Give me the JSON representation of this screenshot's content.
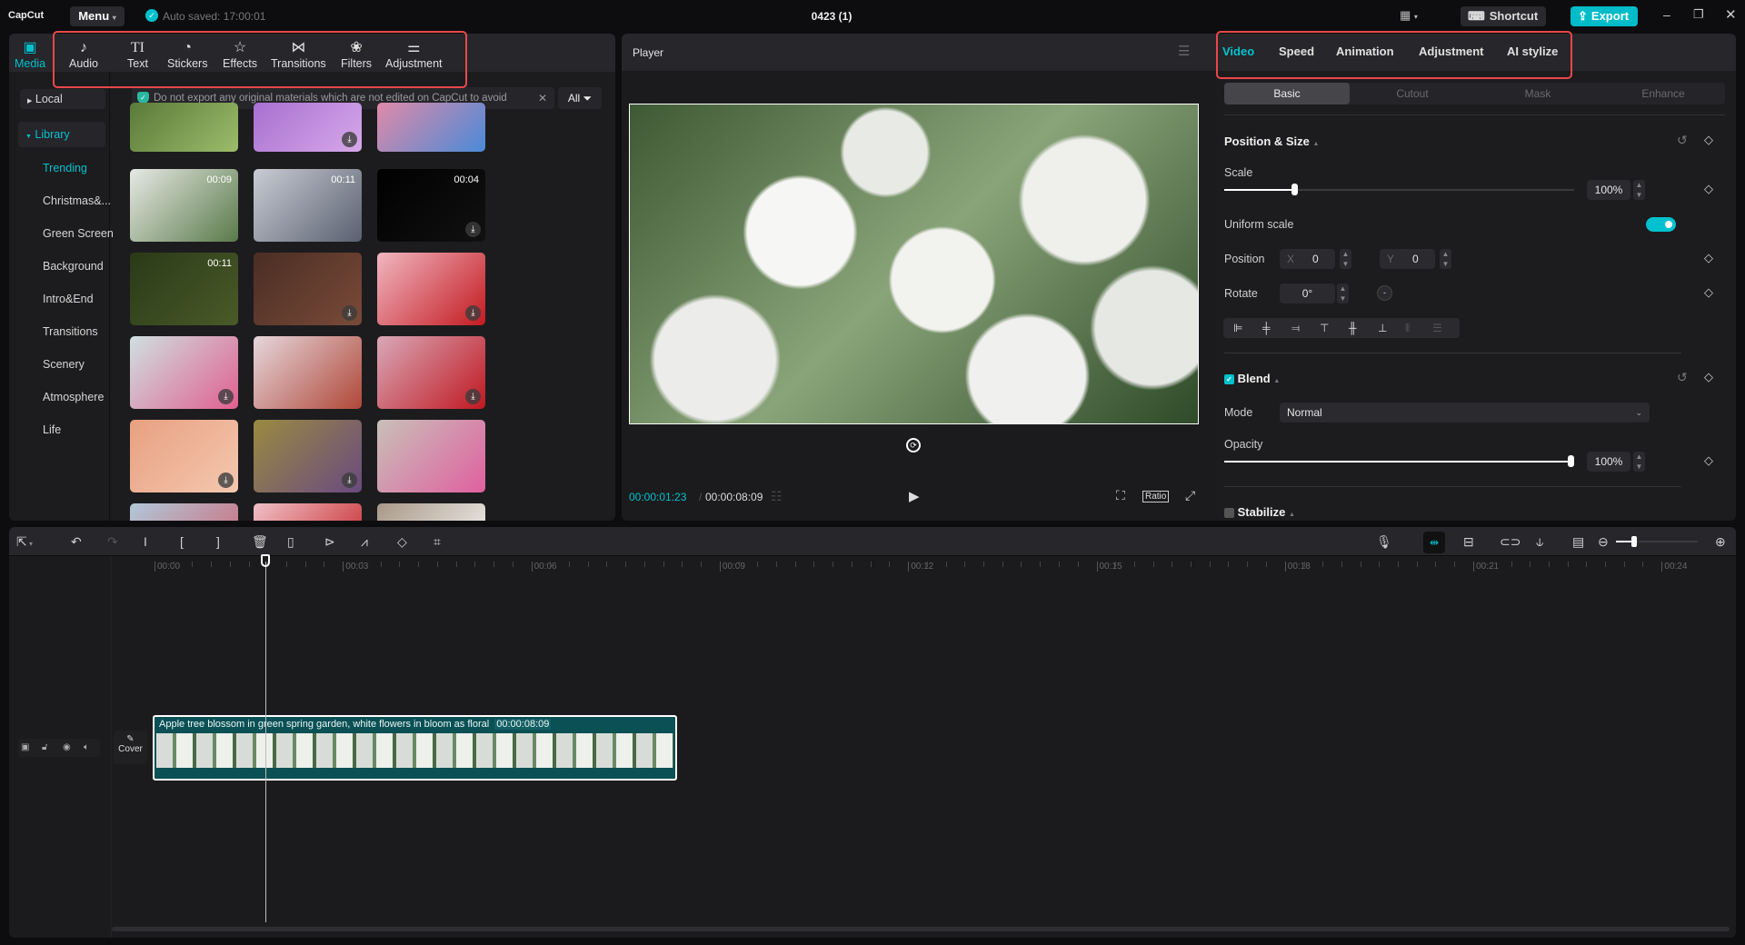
{
  "titlebar": {
    "logo": "CapCut",
    "menu": "Menu",
    "autosave": "Auto saved: 17:00:01",
    "project_title": "0423 (1)",
    "shortcut": "Shortcut",
    "export": "Export"
  },
  "left_tabs": [
    {
      "label": "Media",
      "icon": "media-icon",
      "active": true
    },
    {
      "label": "Audio",
      "icon": "audio-icon"
    },
    {
      "label": "Text",
      "icon": "text-icon"
    },
    {
      "label": "Stickers",
      "icon": "stickers-icon"
    },
    {
      "label": "Effects",
      "icon": "effects-icon"
    },
    {
      "label": "Transitions",
      "icon": "transitions-icon"
    },
    {
      "label": "Filters",
      "icon": "filters-icon"
    },
    {
      "label": "Adjustment",
      "icon": "adjustment-icon"
    }
  ],
  "sidebar": {
    "local": "Local",
    "library": "Library",
    "items": [
      "Trending",
      "Christmas&...",
      "Green Screen",
      "Background",
      "Intro&End",
      "Transitions",
      "Scenery",
      "Atmosphere",
      "Life"
    ]
  },
  "notice": "Do not export any original materials which are not edited on CapCut to avoid",
  "filter_all": "All",
  "thumbnails": [
    {
      "duration": "",
      "download": false,
      "colors": [
        "#5a7a3a",
        "#9cbc6a"
      ]
    },
    {
      "duration": "",
      "download": true,
      "colors": [
        "#a870d0",
        "#d7a8ea"
      ]
    },
    {
      "duration": "",
      "download": false,
      "colors": [
        "#e08aa8",
        "#4a8ad8"
      ]
    },
    {
      "duration": "00:09",
      "download": false,
      "colors": [
        "#e6e9e4",
        "#5a7a4a"
      ]
    },
    {
      "duration": "00:11",
      "download": false,
      "colors": [
        "#c8ccd4",
        "#5a6070"
      ]
    },
    {
      "duration": "00:04",
      "download": true,
      "colors": [
        "#000000",
        "#111111"
      ]
    },
    {
      "duration": "00:11",
      "download": false,
      "colors": [
        "#2a3a18",
        "#4a5a28"
      ]
    },
    {
      "duration": "",
      "download": true,
      "colors": [
        "#4a2e24",
        "#7a4a38"
      ]
    },
    {
      "duration": "",
      "download": true,
      "colors": [
        "#f0b6c0",
        "#c41a20"
      ]
    },
    {
      "duration": "",
      "download": true,
      "colors": [
        "#cfe0e0",
        "#e06090"
      ]
    },
    {
      "duration": "",
      "download": false,
      "colors": [
        "#e6d6dc",
        "#b04838"
      ]
    },
    {
      "duration": "",
      "download": true,
      "colors": [
        "#d8a8b8",
        "#c01820"
      ]
    },
    {
      "duration": "",
      "download": true,
      "colors": [
        "#e8a080",
        "#f4c8b0"
      ]
    },
    {
      "duration": "",
      "download": true,
      "colors": [
        "#9a8a40",
        "#6a4a80"
      ]
    },
    {
      "duration": "",
      "download": false,
      "colors": [
        "#c8c0b8",
        "#e060a0"
      ]
    },
    {
      "duration": "",
      "download": false,
      "colors": [
        "#b0c8d8",
        "#d06070"
      ]
    },
    {
      "duration": "",
      "download": false,
      "colors": [
        "#f0c0c8",
        "#c01818"
      ]
    },
    {
      "duration": "",
      "download": false,
      "colors": [
        "#a89888",
        "#ffffff"
      ]
    }
  ],
  "player": {
    "title": "Player",
    "current_time": "00:00:01:23",
    "total_time": "00:00:08:09",
    "ratio": "Ratio"
  },
  "right_tabs": [
    {
      "label": "Video",
      "active": true
    },
    {
      "label": "Speed"
    },
    {
      "label": "Animation"
    },
    {
      "label": "Adjustment"
    },
    {
      "label": "AI stylize"
    }
  ],
  "sub_tabs": [
    {
      "label": "Basic",
      "active": true
    },
    {
      "label": "Cutout"
    },
    {
      "label": "Mask"
    },
    {
      "label": "Enhance"
    }
  ],
  "position_size": {
    "title": "Position & Size",
    "scale_label": "Scale",
    "scale_value": "100%",
    "scale_fraction": 0.2,
    "uniform_label": "Uniform scale",
    "uniform_on": true,
    "position_label": "Position",
    "x_label": "X",
    "x_value": "0",
    "y_label": "Y",
    "y_value": "0",
    "rotate_label": "Rotate",
    "rotate_value": "0°"
  },
  "blend": {
    "title": "Blend",
    "checked": true,
    "mode_label": "Mode",
    "mode_value": "Normal",
    "opacity_label": "Opacity",
    "opacity_value": "100%",
    "opacity_fraction": 1.0
  },
  "stabilize": {
    "title": "Stabilize",
    "checked": false
  },
  "timeline": {
    "ticks": [
      "00:00",
      "00:03",
      "00:06",
      "00:09",
      "00:12",
      "00:15",
      "00:18",
      "00:21",
      "00:24"
    ],
    "cover": "Cover",
    "clip_title": "Apple tree blossom in green spring garden, white flowers in bloom as floral",
    "clip_duration": "00:00:08:09"
  },
  "accent": "#00c1cd"
}
